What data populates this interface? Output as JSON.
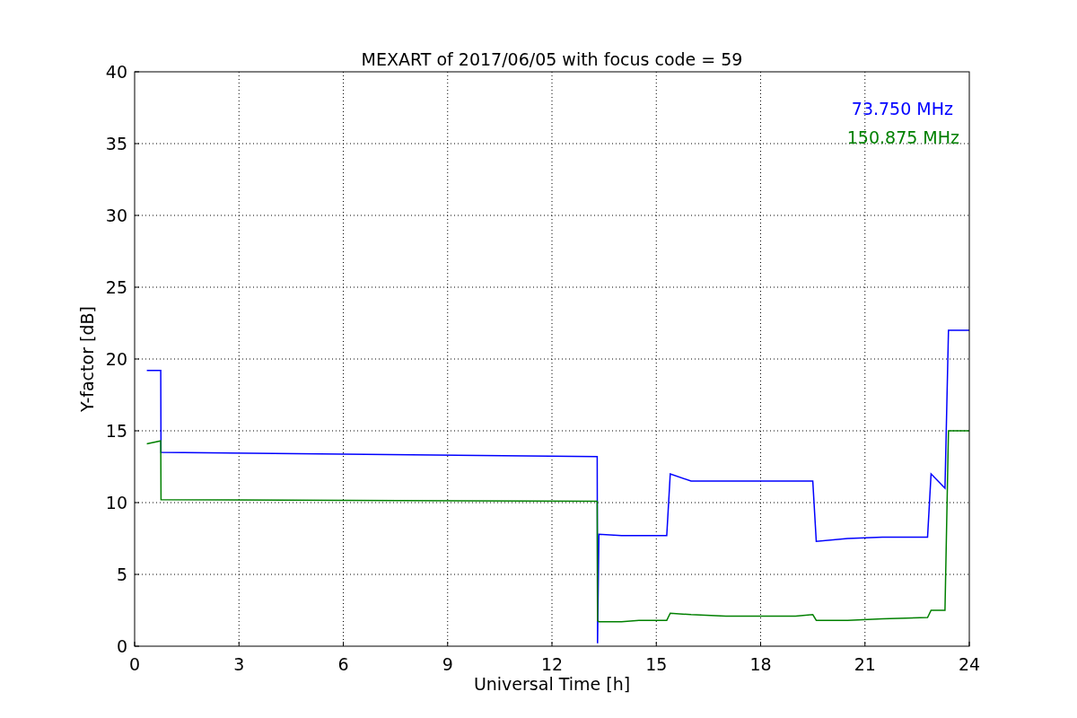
{
  "figure": {
    "chart_data": {
      "type": "line",
      "title": "MEXART of 2017/06/05 with focus code = 59",
      "xlabel": "Universal Time [h]",
      "ylabel": "Y-factor [dB]",
      "x": [
        0.35,
        0.75,
        0.76,
        13.3,
        13.31,
        13.35,
        14.0,
        14.5,
        15.0,
        15.3,
        15.4,
        16.0,
        17.0,
        18.0,
        19.0,
        19.5,
        19.6,
        20.5,
        21.5,
        22.8,
        22.9,
        23.3,
        23.4,
        24
      ],
      "series": [
        {
          "name": "73.750 MHz",
          "color": "#0000ff",
          "values": [
            19.2,
            19.2,
            13.5,
            13.2,
            0.2,
            7.8,
            7.7,
            7.7,
            7.7,
            7.7,
            12,
            11.5,
            11.5,
            11.5,
            11.5,
            11.5,
            7.3,
            7.5,
            7.6,
            7.6,
            12,
            11,
            22,
            22
          ]
        },
        {
          "name": "150.875 MHz",
          "color": "#008000",
          "values": [
            14.1,
            14.3,
            10.2,
            10.1,
            1.8,
            1.7,
            1.7,
            1.8,
            1.8,
            1.8,
            2.3,
            2.2,
            2.1,
            2.1,
            2.1,
            2.2,
            1.8,
            1.8,
            1.9,
            2,
            2.5,
            2.5,
            15,
            15
          ]
        }
      ],
      "grid": true,
      "xlim": [
        0,
        24
      ],
      "ylim": [
        0,
        40
      ],
      "xticks": [
        0,
        3,
        6,
        9,
        12,
        15,
        18,
        21,
        24
      ],
      "yticks": [
        0,
        5,
        10,
        15,
        20,
        25,
        30,
        35,
        40
      ]
    }
  }
}
